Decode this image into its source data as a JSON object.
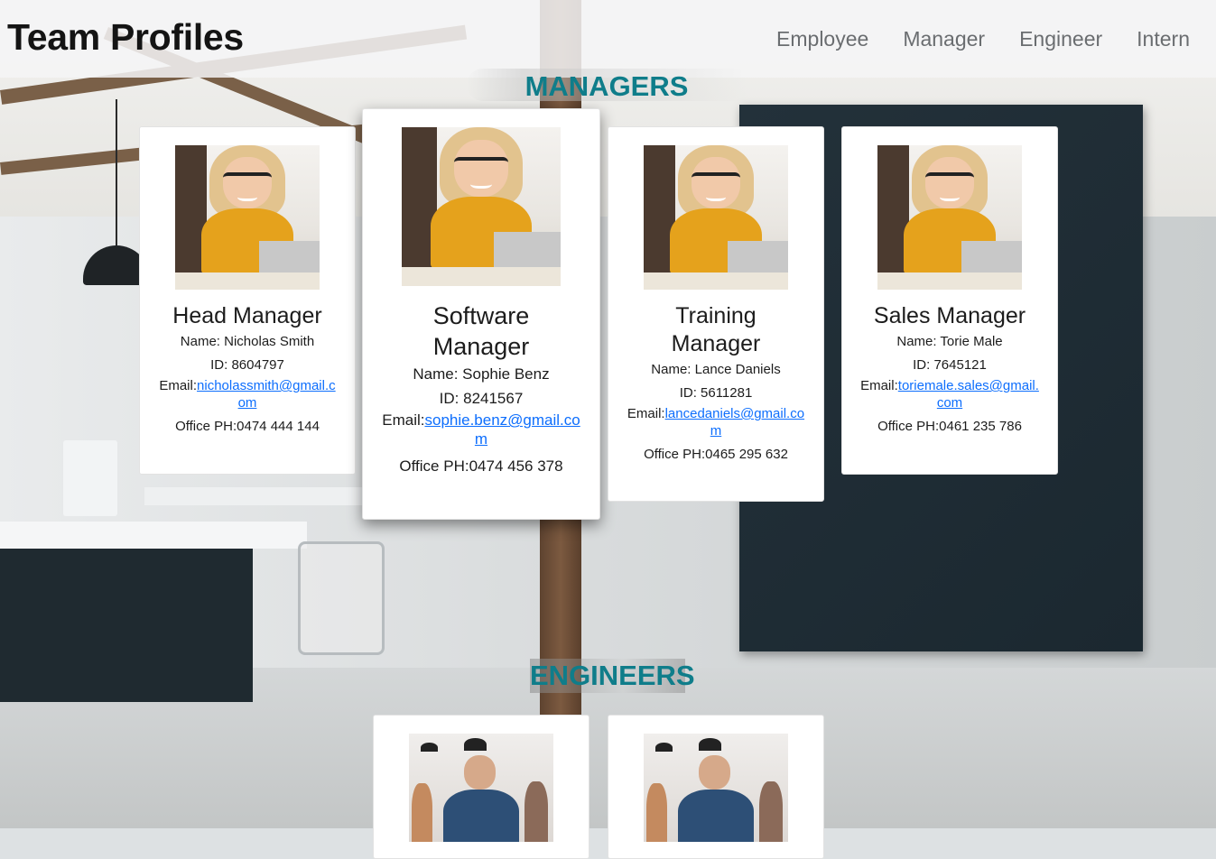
{
  "app": {
    "title": "Team Profiles"
  },
  "nav": {
    "items": [
      "Employee",
      "Manager",
      "Engineer",
      "Intern"
    ]
  },
  "sections": {
    "managers_title": "MANAGERS",
    "engineers_title": "ENGINEERS"
  },
  "managers": [
    {
      "role": "Head Manager",
      "name": "Name: Nicholas Smith",
      "id": "ID: 8604797",
      "email_label": "Email:",
      "email": "nicholassmith@gmail.com",
      "office": "Office PH:0474 444 144"
    },
    {
      "role": "Software Manager",
      "name": "Name: Sophie Benz",
      "id": "ID: 8241567",
      "email_label": "Email:",
      "email": "sophie.benz@gmail.com",
      "office": "Office PH:0474 456 378"
    },
    {
      "role": "Training Manager",
      "name": "Name: Lance Daniels",
      "id": "ID: 5611281",
      "email_label": "Email:",
      "email": "lancedaniels@gmail.com",
      "office": "Office PH:0465 295 632"
    },
    {
      "role": "Sales Manager",
      "name": "Name: Torie Male",
      "id": "ID: 7645121",
      "email_label": "Email:",
      "email": "toriemale.sales@gmail.com",
      "office": "Office PH:0461 235 786"
    }
  ],
  "colors": {
    "section_title": "#0f7d8a",
    "link": "#0d6efd",
    "header_bg": "#f4f5f6"
  }
}
